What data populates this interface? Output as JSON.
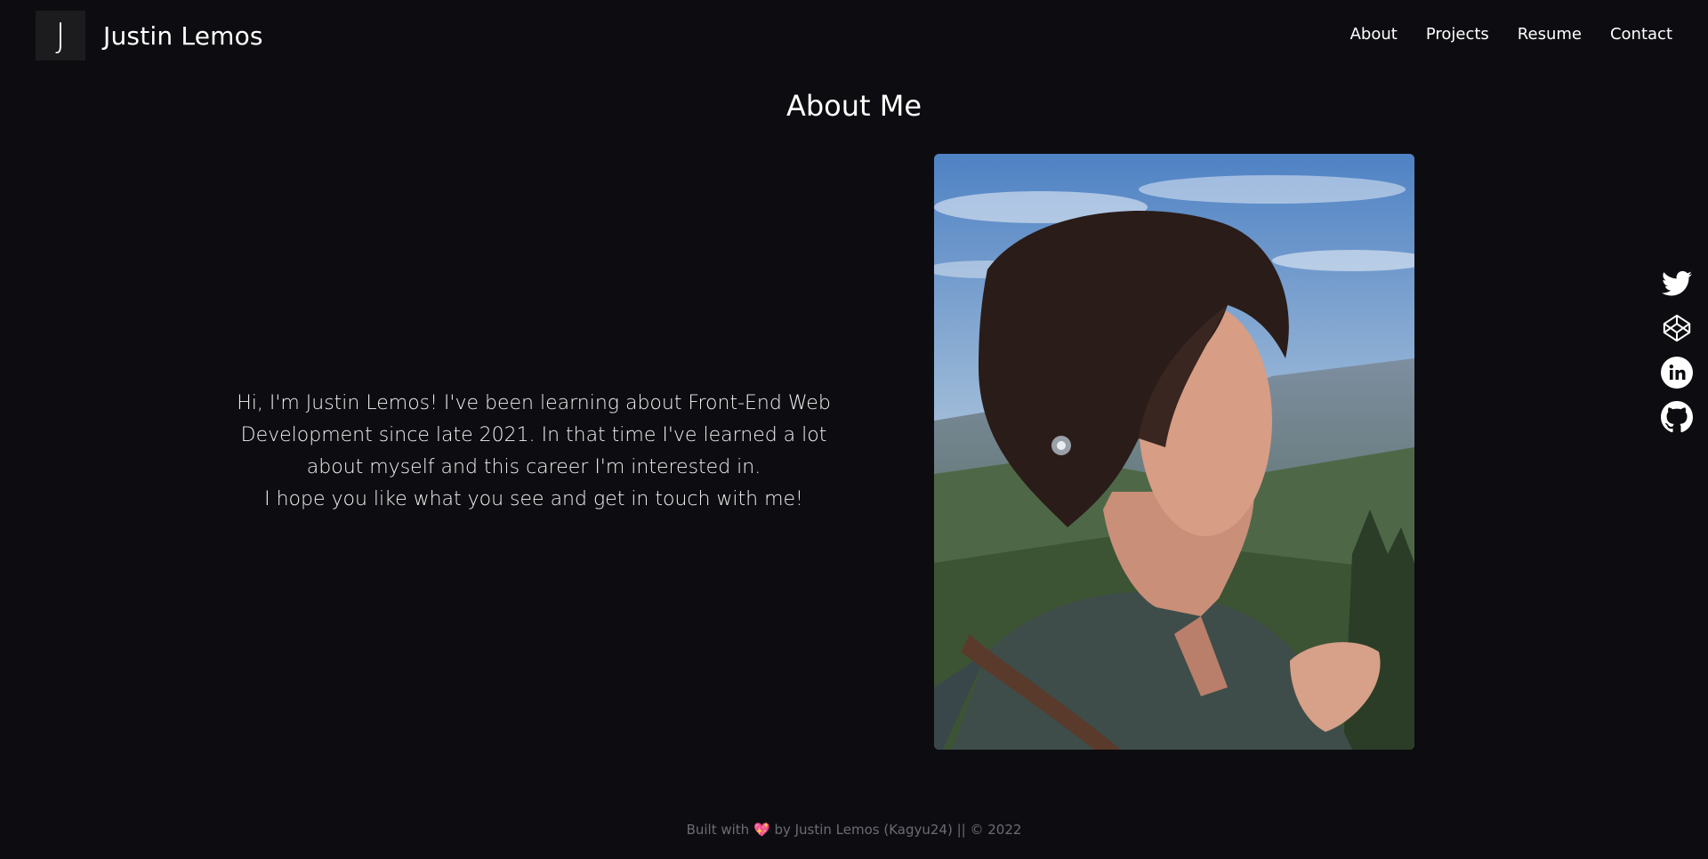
{
  "nav": {
    "logo_letter": "J",
    "brand_name": "Justin Lemos",
    "links": [
      "About",
      "Projects",
      "Resume",
      "Contact"
    ]
  },
  "about": {
    "title": "About Me",
    "paragraph_1": "Hi, I'm Justin Lemos! I've been learning about Front-End Web Development since late 2021. In that time I've learned a lot about myself and this career I'm interested in.",
    "paragraph_2": "I hope you like what you see and get in touch with me!"
  },
  "socials": [
    "twitter-icon",
    "codepen-icon",
    "linkedin-icon",
    "github-icon"
  ],
  "footer": {
    "prefix": "Built with",
    "heart": "💖",
    "suffix": "by Justin Lemos (Kagyu24) || © 2022"
  },
  "colors": {
    "background": "#0d0d11",
    "text": "#ffffff",
    "footer_text": "#6b6b75",
    "logo_box": "#1c1c1f"
  }
}
